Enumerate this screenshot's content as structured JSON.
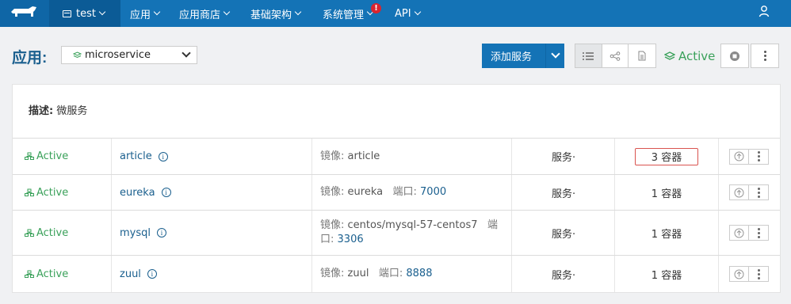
{
  "nav": {
    "env_label": "test",
    "items": [
      "应用",
      "应用商店",
      "基础架构",
      "系统管理",
      "API"
    ],
    "alert_badge": "!"
  },
  "app": {
    "label": "应用:",
    "selected_stack": "microservice",
    "add_service_label": "添加服务",
    "state": "Active"
  },
  "description": {
    "label": "描述:",
    "value": "微服务"
  },
  "services": [
    {
      "state": "Active",
      "name": "article",
      "image_label": "镜像:",
      "image": "article",
      "port_label": "",
      "port": "",
      "type": "服务·",
      "containers": "3 容器",
      "highlight": true
    },
    {
      "state": "Active",
      "name": "eureka",
      "image_label": "镜像:",
      "image": "eureka",
      "port_label": "端口:",
      "port": "7000",
      "type": "服务·",
      "containers": "1 容器",
      "highlight": false
    },
    {
      "state": "Active",
      "name": "mysql",
      "image_label": "镜像:",
      "image": "centos/mysql-57-centos7",
      "port_label": "端口:",
      "port": "3306",
      "type": "服务·",
      "containers": "1 容器",
      "highlight": false
    },
    {
      "state": "Active",
      "name": "zuul",
      "image_label": "镜像:",
      "image": "zuul",
      "port_label": "端口:",
      "port": "8888",
      "type": "服务·",
      "containers": "1 容器",
      "highlight": false
    }
  ],
  "colors": {
    "nav_bg": "#1473b6",
    "primary": "#1473b6",
    "active_green": "#3aa15a",
    "link_blue": "#1a5f8e",
    "highlight_border": "#d9534f"
  }
}
